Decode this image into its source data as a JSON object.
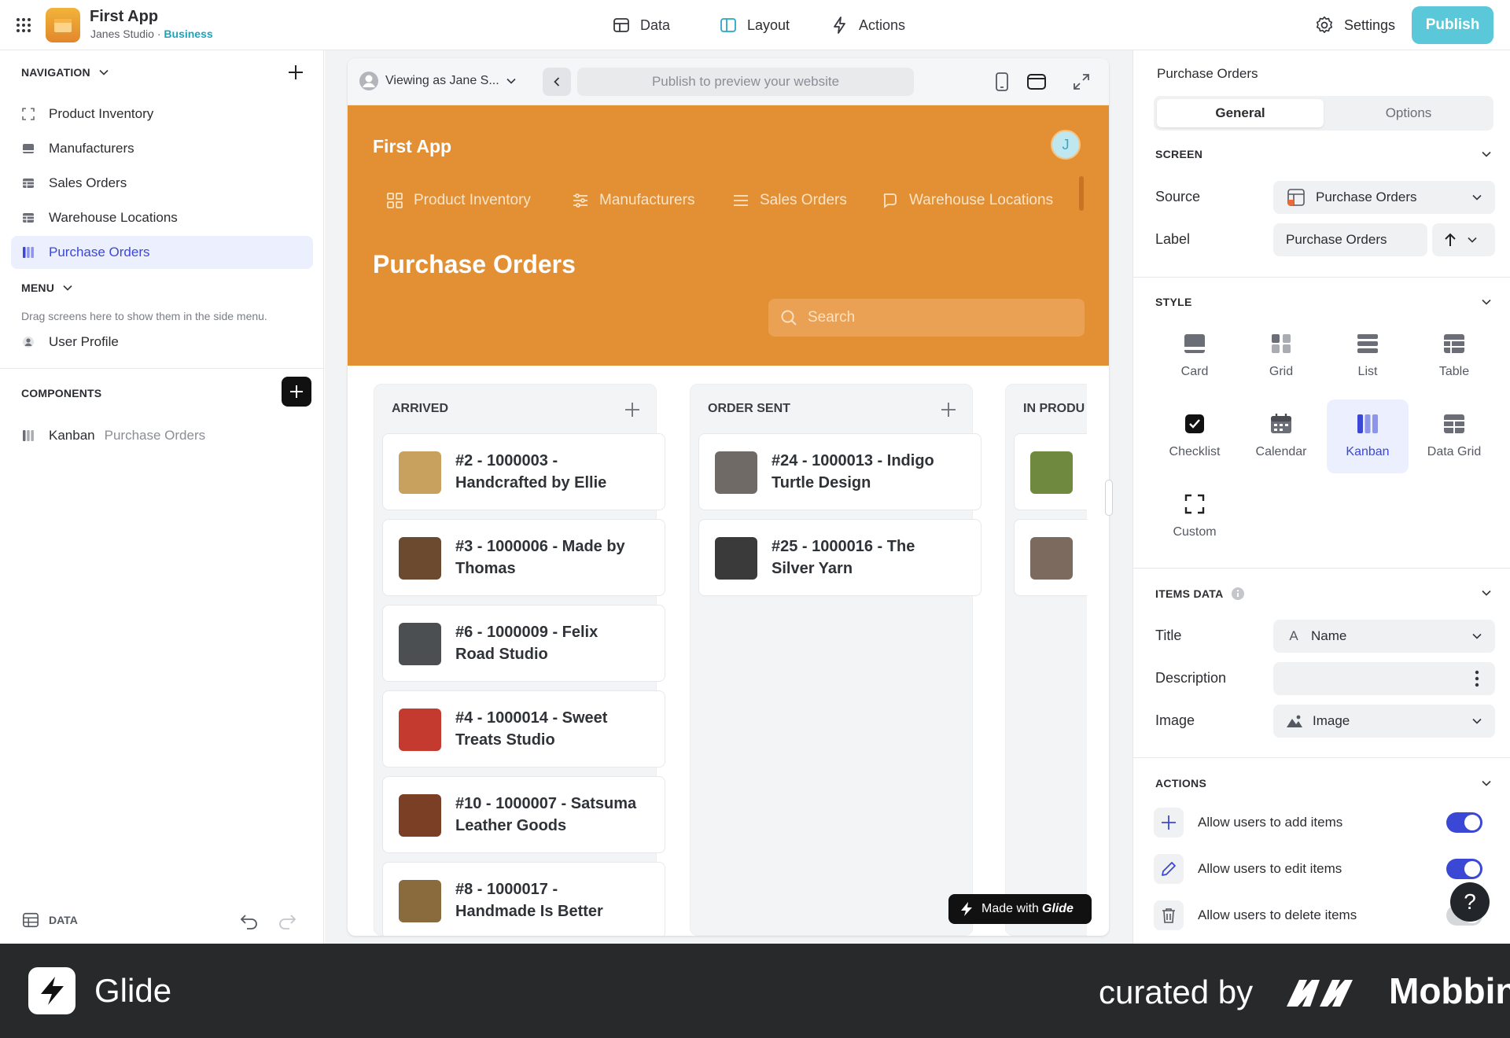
{
  "topbar": {
    "app_title": "First App",
    "workspace": "Janes Studio",
    "separator": "·",
    "plan": "Business",
    "tabs": [
      {
        "label": "Data"
      },
      {
        "label": "Layout"
      },
      {
        "label": "Actions"
      }
    ],
    "settings_label": "Settings",
    "publish_label": "Publish"
  },
  "left": {
    "navigation_header": "NAVIGATION",
    "nav_items": [
      {
        "label": "Product Inventory"
      },
      {
        "label": "Manufacturers"
      },
      {
        "label": "Sales Orders"
      },
      {
        "label": "Warehouse Locations"
      },
      {
        "label": "Purchase Orders"
      }
    ],
    "menu_header": "MENU",
    "menu_hint": "Drag screens here to show them in the side menu.",
    "menu_item": "User Profile",
    "components_header": "COMPONENTS",
    "component_name": "Kanban",
    "component_source": "Purchase Orders",
    "data_label": "DATA"
  },
  "preview": {
    "viewing_as": "Viewing as Jane S...",
    "url_placeholder": "Publish to preview your website",
    "app_title": "First App",
    "avatar_initial": "J",
    "tabs": [
      {
        "label": "Product Inventory"
      },
      {
        "label": "Manufacturers"
      },
      {
        "label": "Sales Orders"
      },
      {
        "label": "Warehouse Locations"
      }
    ],
    "screen_title": "Purchase Orders",
    "search_placeholder": "Search",
    "made_with_prefix": "Made with",
    "made_with_brand": "Glide"
  },
  "kanban": {
    "columns": [
      {
        "title": "ARRIVED",
        "cards": [
          {
            "line1": "#2 - 1000003 -",
            "line2": "Handcrafted by Ellie",
            "thumb": "#c9a15e"
          },
          {
            "line1": "#3 - 1000006 - Made by",
            "line2": "Thomas",
            "thumb": "#6b4a30"
          },
          {
            "line1": "#6 - 1000009 - Felix",
            "line2": "Road Studio",
            "thumb": "#4b4f52"
          },
          {
            "line1": "#4 - 1000014 - Sweet",
            "line2": "Treats Studio",
            "thumb": "#c43a2e"
          },
          {
            "line1": "#10 - 1000007 - Satsuma",
            "line2": "Leather Goods",
            "thumb": "#7a3f24"
          },
          {
            "line1": "#8 - 1000017 -",
            "line2": "Handmade Is Better",
            "thumb": "#8a6b3e"
          }
        ]
      },
      {
        "title": "ORDER SENT",
        "cards": [
          {
            "line1": "#24 - 1000013 - Indigo",
            "line2": "Turtle Design",
            "thumb": "#6f6a66"
          },
          {
            "line1": "#25 - 1000016 - The",
            "line2": "Silver Yarn",
            "thumb": "#3a3a3a"
          }
        ]
      },
      {
        "title": "IN PRODU",
        "cards": [
          {
            "line1": "",
            "line2": "",
            "thumb": "#6f8a3e"
          },
          {
            "line1": "",
            "line2": "",
            "thumb": "#7d6a5e"
          }
        ]
      }
    ]
  },
  "right": {
    "title": "Purchase Orders",
    "seg_general": "General",
    "seg_options": "Options",
    "screen_header": "SCREEN",
    "source_label": "Source",
    "source_value": "Purchase Orders",
    "label_label": "Label",
    "label_value": "Purchase Orders",
    "style_header": "STYLE",
    "styles": [
      {
        "label": "Card"
      },
      {
        "label": "Grid"
      },
      {
        "label": "List"
      },
      {
        "label": "Table"
      },
      {
        "label": "Checklist"
      },
      {
        "label": "Calendar"
      },
      {
        "label": "Kanban"
      },
      {
        "label": "Data Grid"
      },
      {
        "label": "Custom"
      }
    ],
    "items_header": "ITEMS DATA",
    "title_label": "Title",
    "title_value": "Name",
    "title_type_glyph": "A",
    "description_label": "Description",
    "image_label": "Image",
    "image_value": "Image",
    "actions_header": "ACTIONS",
    "actions": [
      {
        "label": "Allow users to add items"
      },
      {
        "label": "Allow users to edit items"
      },
      {
        "label": "Allow users to delete items"
      }
    ],
    "help_glyph": "?"
  },
  "footer": {
    "brand": "Glide",
    "curated_by": "curated by",
    "mobbin": "Mobbin"
  },
  "colors": {
    "accent": "#3b48d6",
    "preview_header": "#e39035",
    "publish": "#5ac8d8"
  }
}
